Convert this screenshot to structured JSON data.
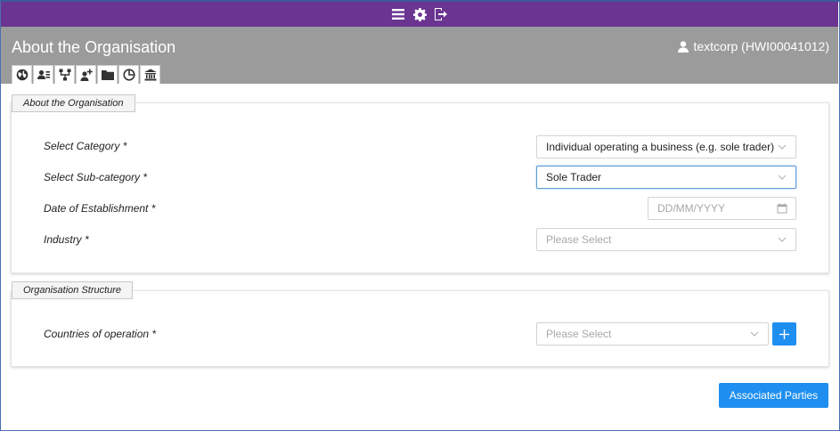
{
  "top_bar": {
    "icons": [
      "menu-icon",
      "gear-icon",
      "sign-out-icon"
    ]
  },
  "header": {
    "title": "About the Organisation",
    "user_label": "textcorp (HWI00041012)",
    "tabs": [
      {
        "icon": "globe-icon"
      },
      {
        "icon": "contact-card-icon"
      },
      {
        "icon": "org-structure-icon"
      },
      {
        "icon": "add-user-icon"
      },
      {
        "icon": "folder-icon"
      },
      {
        "icon": "pie-chart-icon"
      },
      {
        "icon": "bank-icon"
      }
    ]
  },
  "about_section": {
    "legend": "About the Organisation",
    "category_label": "Select Category *",
    "category_value": "Individual operating a business (e.g. sole trader)",
    "subcategory_label": "Select Sub-category *",
    "subcategory_value": "Sole Trader",
    "date_label": "Date of Establishment *",
    "date_placeholder": "DD/MM/YYYY",
    "industry_label": "Industry *",
    "industry_placeholder": "Please Select"
  },
  "structure_section": {
    "legend": "Organisation Structure",
    "countries_label": "Countries of operation *",
    "countries_placeholder": "Please Select"
  },
  "actions": {
    "associated_parties_label": "Associated Parties"
  },
  "colors": {
    "top_bar": "#6a3491",
    "header": "#9b9b9b",
    "primary": "#1e8ff0"
  }
}
